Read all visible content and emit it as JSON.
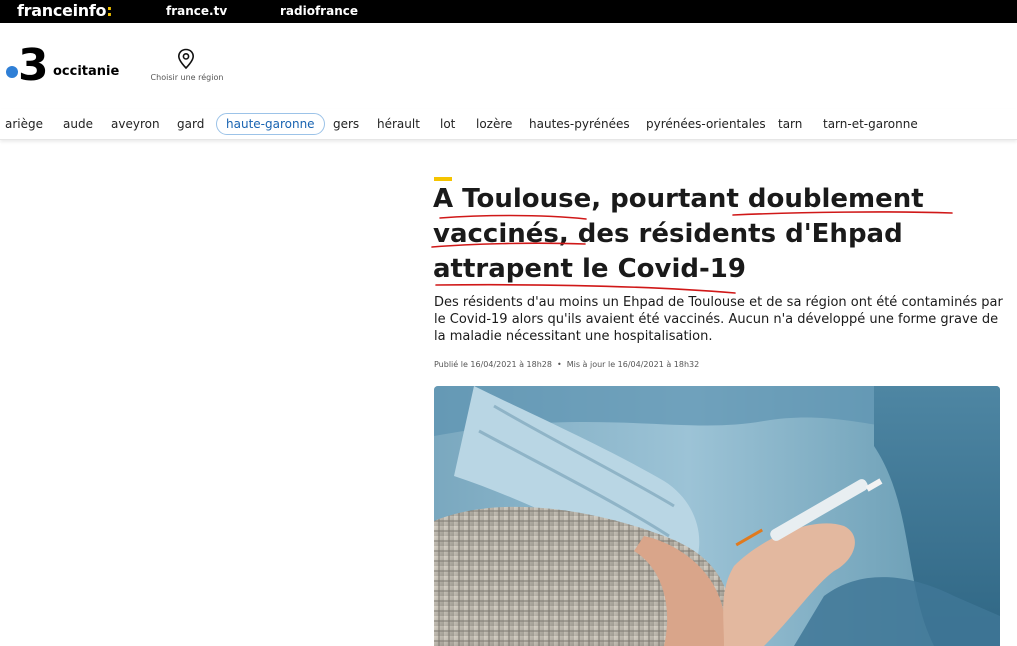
{
  "topbar": {
    "brand": "franceinfo",
    "brand_suffix": ":",
    "links": [
      "france.tv",
      "radiofrance"
    ]
  },
  "header": {
    "logo_number": "3",
    "region_name": "occitanie",
    "region_chooser_label": "Choisir une région"
  },
  "departments": {
    "items": [
      "ariège",
      "aude",
      "aveyron",
      "gard",
      "haute-garonne",
      "gers",
      "hérault",
      "lot",
      "lozère",
      "hautes-pyrénées",
      "pyrénées-orientales",
      "tarn",
      "tarn-et-garonne"
    ],
    "active": "haute-garonne"
  },
  "article": {
    "headline_line1": "A Toulouse, pourtant doublement",
    "headline_line2": "vaccinés, des résidents d'Ehpad",
    "headline_line3": "attrapent le Covid-19",
    "lede": "Des résidents d'au moins un Ehpad de Toulouse et de sa région ont été contaminés par le Covid-19 alors qu'ils avaient été vaccinés. Aucun n'a développé une forme grave de la maladie nécessitant une hospitalisation.",
    "published": "Publié le 16/04/2021 à 18h28",
    "separator": "•",
    "updated": "Mis à jour le 16/04/2021 à 18h32"
  },
  "colors": {
    "accent": "#f5c400",
    "logo_dot": "#2f7fd6",
    "active_department": "#1863b1",
    "annotation": "#d01818"
  },
  "icons": {
    "region_chooser": "map-pin-icon"
  }
}
